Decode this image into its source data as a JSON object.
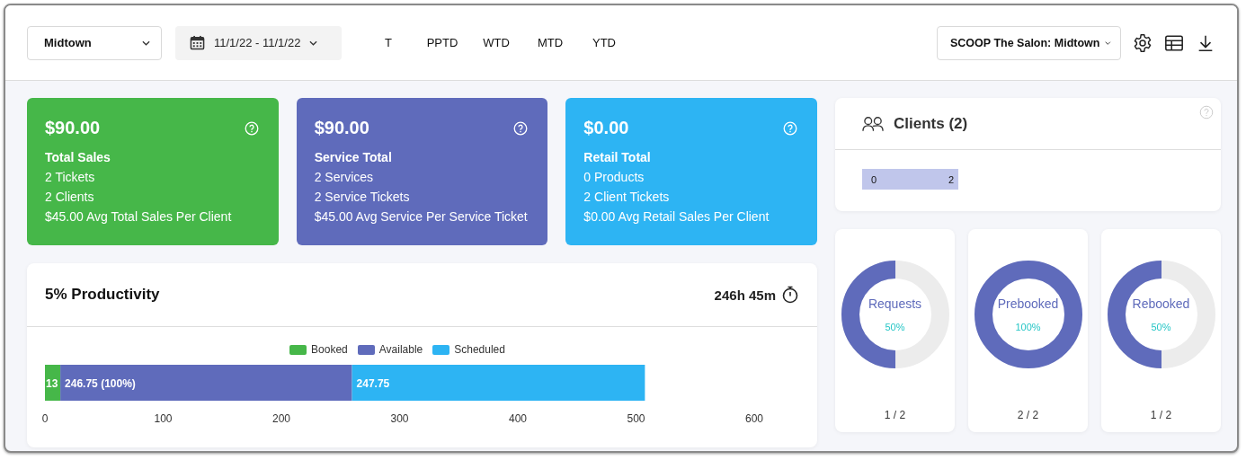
{
  "header": {
    "location_select": "Midtown",
    "date_range": "11/1/22 - 11/1/22",
    "periods": [
      "T",
      "PPTD",
      "WTD",
      "MTD",
      "YTD"
    ],
    "salon_select": "SCOOP The Salon: Midtown"
  },
  "stat_cards": [
    {
      "color": "#46b749",
      "value": "$90.00",
      "title": "Total Sales",
      "lines": [
        "2 Tickets",
        "2 Clients",
        "$45.00 Avg Total Sales Per Client"
      ]
    },
    {
      "color": "#5f6bbb",
      "value": "$90.00",
      "title": "Service Total",
      "lines": [
        "2 Services",
        "2 Service Tickets",
        "$45.00 Avg Service Per Service Ticket"
      ]
    },
    {
      "color": "#2db4f3",
      "value": "$0.00",
      "title": "Retail Total",
      "lines": [
        "0 Products",
        "2 Client Tickets",
        "$0.00 Avg Retail Sales Per Client"
      ]
    }
  ],
  "productivity": {
    "title": "5% Productivity",
    "duration": "246h 45m",
    "chart_data": {
      "type": "bar",
      "orientation": "horizontal",
      "stacked": true,
      "legend": "top",
      "series": [
        {
          "name": "Booked",
          "color": "#46b749",
          "values": [
            13
          ]
        },
        {
          "name": "Available",
          "color": "#5f6bbb",
          "values": [
            246.75
          ]
        },
        {
          "name": "Scheduled",
          "color": "#2db4f3",
          "values": [
            247.75
          ]
        }
      ],
      "value_labels": [
        "13",
        "246.75 (100%)",
        "247.75"
      ],
      "xlim": [
        0,
        600
      ],
      "xticks": [
        0,
        100,
        200,
        300,
        400,
        500,
        600
      ]
    }
  },
  "clients": {
    "title": "Clients (2)",
    "bar_start": "0",
    "bar_end": "2"
  },
  "donuts": [
    {
      "label": "Requests",
      "percent": "50%",
      "count": "1 / 2"
    },
    {
      "label": "Prebooked",
      "percent": "100%",
      "count": "2 / 2"
    },
    {
      "label": "Rebooked",
      "percent": "50%",
      "count": "1 / 2"
    }
  ]
}
